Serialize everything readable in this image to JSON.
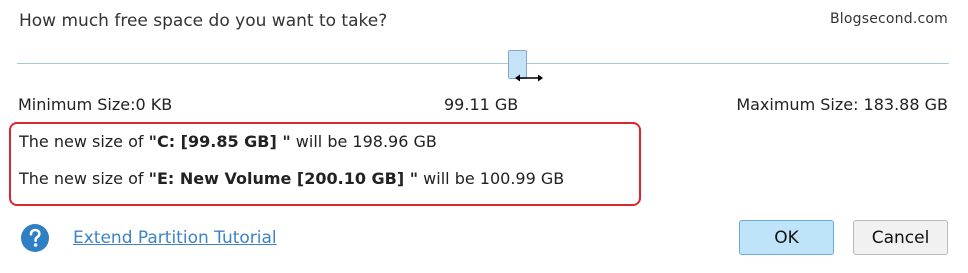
{
  "dialog": {
    "question": "How much free space do you want to take?",
    "watermark": "Blogsecond.com"
  },
  "slider": {
    "minimum_label": "Minimum Size:0 KB",
    "current_value": "99.11 GB",
    "maximum_label": "Maximum Size: 183.88 GB"
  },
  "summary": {
    "line1": {
      "prefix": "The new size of ",
      "partition": "\"C: [99.85 GB] \"",
      "suffix": " will be 198.96 GB"
    },
    "line2": {
      "prefix": "The new size of ",
      "partition": "\"E: New Volume [200.10 GB] \"",
      "suffix": " will be 100.99 GB"
    }
  },
  "footer": {
    "help_icon": "question-circle-icon",
    "tutorial_link": "Extend Partition Tutorial",
    "ok_label": "OK",
    "cancel_label": "Cancel"
  },
  "colors": {
    "highlight_border": "#dd2430",
    "link": "#3d84c6",
    "ok_button_bg": "#bfe3f9",
    "help_icon": "#2f7fc4"
  }
}
